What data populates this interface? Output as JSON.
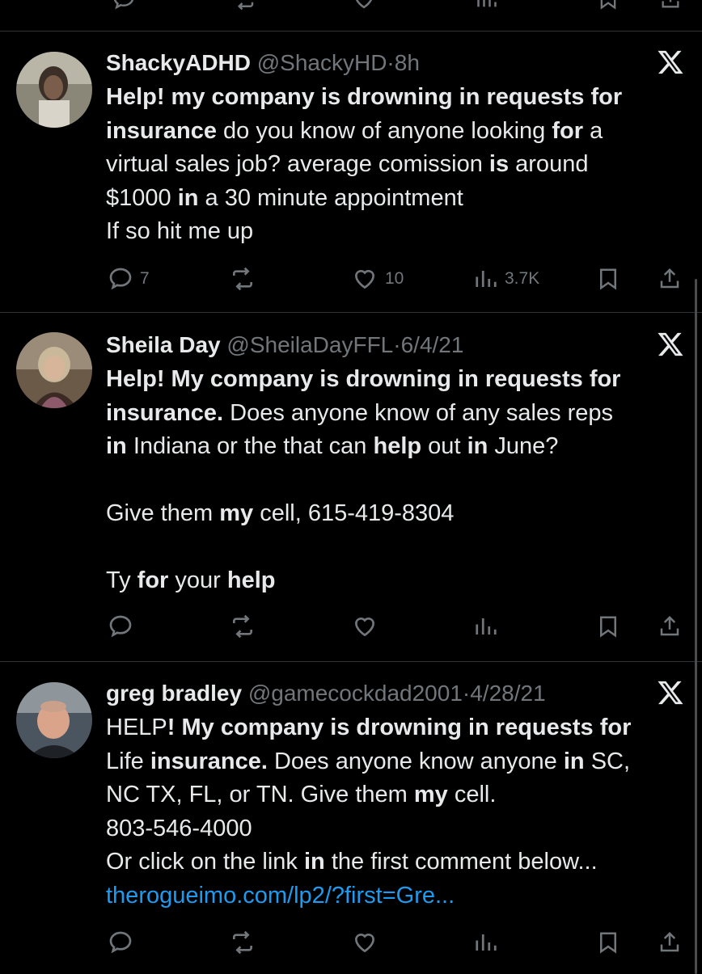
{
  "tweets": [
    {
      "name": "ShackyADHD",
      "handle": "@ShackyHD",
      "sep": "·",
      "time": "8h",
      "lines": [
        [
          {
            "t": "Help! my company is drowning in requests for",
            "b": true
          }
        ],
        [
          {
            "t": "insurance",
            "b": true
          },
          {
            "t": " do you know of anyone looking ",
            "b": false
          },
          {
            "t": "for",
            "b": true
          },
          {
            "t": " a",
            "b": false
          }
        ],
        [
          {
            "t": "virtual sales job? average comission ",
            "b": false
          },
          {
            "t": "is",
            "b": true
          },
          {
            "t": " around",
            "b": false
          }
        ],
        [
          {
            "t": "$1000 ",
            "b": false
          },
          {
            "t": "in",
            "b": true
          },
          {
            "t": " a 30 minute appointment",
            "b": false
          }
        ],
        [
          {
            "t": "If so hit me up",
            "b": false
          }
        ]
      ],
      "stats": {
        "replies": "7",
        "retweets": "",
        "likes": "10",
        "views": "3.7K"
      }
    },
    {
      "name": "Sheila Day",
      "handle": "@SheilaDayFFL",
      "sep": "·",
      "time": "6/4/21",
      "lines": [
        [
          {
            "t": "Help! My company is drowning in requests for",
            "b": true
          }
        ],
        [
          {
            "t": "insurance.",
            "b": true
          },
          {
            "t": " Does anyone know of any sales reps",
            "b": false
          }
        ],
        [
          {
            "t": "in",
            "b": true
          },
          {
            "t": " Indiana or the  that can ",
            "b": false
          },
          {
            "t": "help",
            "b": true
          },
          {
            "t": " out ",
            "b": false
          },
          {
            "t": "in",
            "b": true
          },
          {
            "t": " June?",
            "b": false
          }
        ],
        [],
        [
          {
            "t": "Give them ",
            "b": false
          },
          {
            "t": "my",
            "b": true
          },
          {
            "t": " cell, 615-419-8304",
            "b": false
          }
        ],
        [],
        [
          {
            "t": "Ty ",
            "b": false
          },
          {
            "t": "for",
            "b": true
          },
          {
            "t": " your ",
            "b": false
          },
          {
            "t": "help",
            "b": true
          }
        ]
      ],
      "stats": {
        "replies": "",
        "retweets": "",
        "likes": "",
        "views": ""
      }
    },
    {
      "name": "greg bradley",
      "handle": "@gamecockdad2001",
      "sep": "·",
      "time": "4/28/21",
      "lines": [
        [
          {
            "t": "HELP",
            "b": false
          },
          {
            "t": "! My company is drowning in requests for",
            "b": true
          }
        ],
        [
          {
            "t": "Life ",
            "b": false
          },
          {
            "t": "insurance.",
            "b": true
          },
          {
            "t": " Does anyone know anyone ",
            "b": false
          },
          {
            "t": "in",
            "b": true
          },
          {
            "t": " SC,",
            "b": false
          }
        ],
        [
          {
            "t": "NC TX, FL, or TN. Give them ",
            "b": false
          },
          {
            "t": "my",
            "b": true
          },
          {
            "t": " cell.",
            "b": false
          }
        ],
        [
          {
            "t": "803-546-4000",
            "b": false
          }
        ],
        [
          {
            "t": "Or click on the link ",
            "b": false
          },
          {
            "t": "in",
            "b": true
          },
          {
            "t": " the first comment below...",
            "b": false
          }
        ],
        [
          {
            "t": "therogueimo.com/lp2/?first=Gre...",
            "b": false,
            "link": true
          }
        ]
      ],
      "stats": {
        "replies": "",
        "retweets": "",
        "likes": "",
        "views": ""
      }
    }
  ],
  "icons": {
    "reply": "reply-icon",
    "retweet": "retweet-icon",
    "like": "heart-icon",
    "views": "views-icon",
    "bookmark": "bookmark-icon",
    "share": "share-icon",
    "x": "x-logo-icon"
  },
  "colors": {
    "background": "#000000",
    "text": "#e7e9ea",
    "muted": "#71767b",
    "link": "#1d9bf0",
    "divider": "#2f3336"
  }
}
